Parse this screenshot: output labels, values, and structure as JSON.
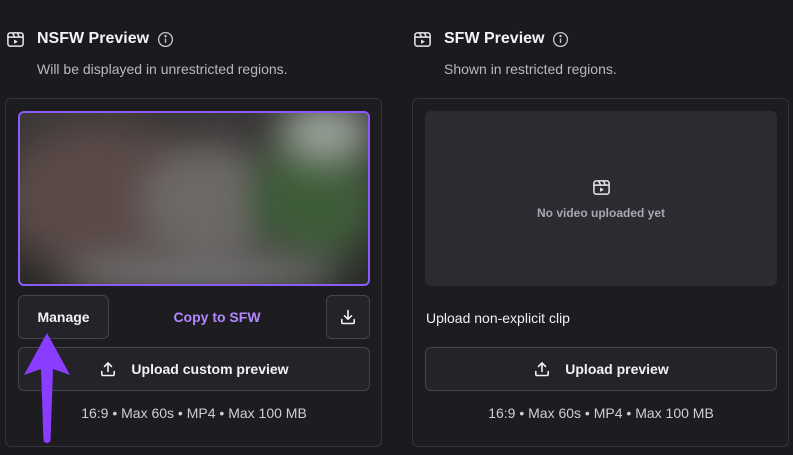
{
  "nsfw": {
    "title": "NSFW Preview",
    "subtitle": "Will be displayed in unrestricted regions.",
    "manage_label": "Manage",
    "copy_label": "Copy to SFW",
    "upload_label": "Upload custom preview",
    "specs": "16:9 • Max 60s • MP4 • Max 100 MB"
  },
  "sfw": {
    "title": "SFW Preview",
    "subtitle": "Shown in restricted regions.",
    "empty_message": "No video uploaded yet",
    "clip_label": "Upload non-explicit clip",
    "upload_label": "Upload preview",
    "specs": "16:9 • Max 60s • MP4 • Max 100 MB"
  },
  "icons": {
    "section": "video-clip-icon",
    "info": "info-icon",
    "download": "download-icon",
    "upload": "upload-icon",
    "annotation": "arrow-up-icon"
  },
  "colors": {
    "background": "#1b1a1f",
    "accent": "#8b5cf6",
    "link": "#b288ff",
    "annotation_arrow": "#8b3dff"
  }
}
